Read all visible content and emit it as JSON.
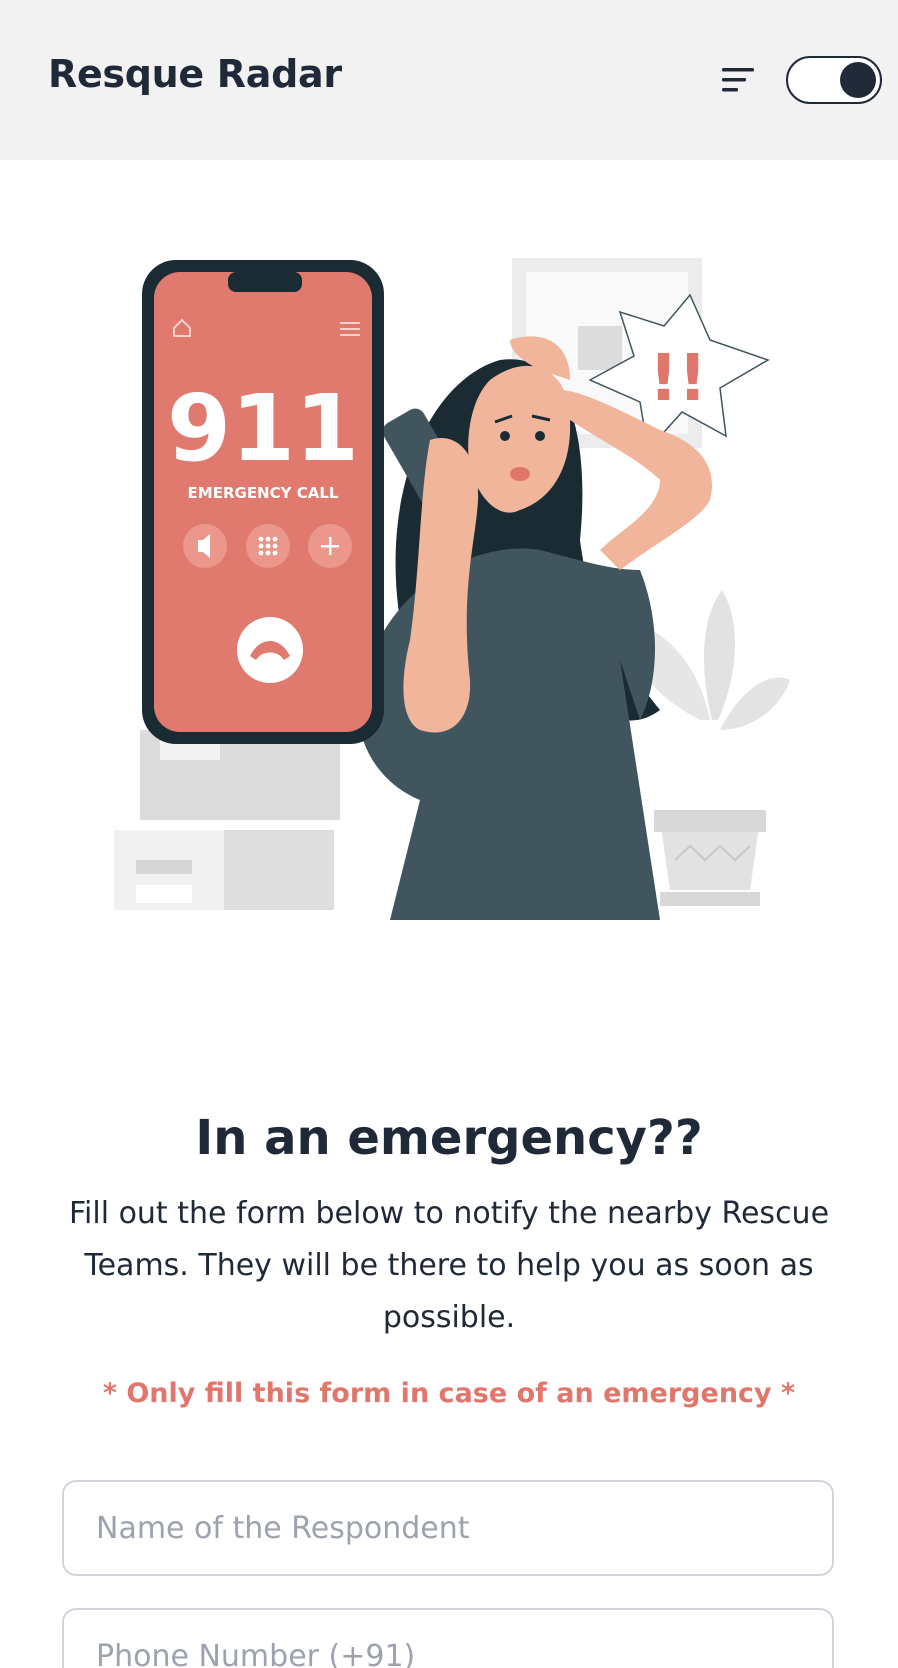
{
  "header": {
    "brand": "Resque Radar",
    "menu_icon": "menu-icon",
    "theme_toggle": "dark-mode-toggle"
  },
  "illustration": {
    "phone_number": "911",
    "phone_caption": "EMERGENCY CALL",
    "alert_text": "!!",
    "icons": [
      "home-icon",
      "menu-icon",
      "speaker-icon",
      "keypad-icon",
      "plus-icon",
      "hang-up-icon"
    ]
  },
  "main": {
    "title": "In an emergency??",
    "description": "Fill out the form below to notify the nearby Rescue Teams. They will be there to help you as soon as possible.",
    "warning": "* Only fill this form in case of an emergency *"
  },
  "form": {
    "name_placeholder": "Name of the Respondent",
    "phone_placeholder": "Phone Number (+91)"
  },
  "colors": {
    "accent": "#e0766c",
    "dark": "#1f2937",
    "header_bg": "#f2f2f2"
  }
}
